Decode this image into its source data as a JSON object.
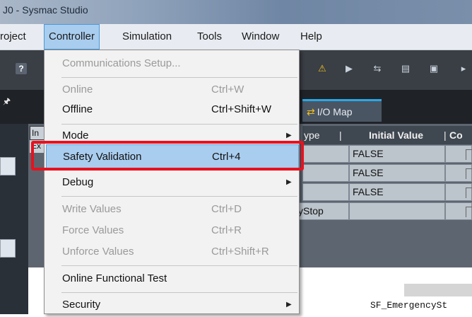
{
  "window": {
    "title": "J0 - Sysmac Studio"
  },
  "menubar": {
    "items": [
      {
        "label": "roject"
      },
      {
        "label": "Controller"
      },
      {
        "label": "Simulation"
      },
      {
        "label": "Tools"
      },
      {
        "label": "Window"
      },
      {
        "label": "Help"
      }
    ]
  },
  "toolbar": {
    "icons": [
      "help-icon",
      "safety-icon",
      "step-icon",
      "sync-icon",
      "transfer-icon",
      "compare-icon",
      "more-icon"
    ]
  },
  "tabs": {
    "io_map": "I/O Map"
  },
  "panel": {
    "in_label": "In",
    "e_label": "Ex"
  },
  "grid": {
    "headers": [
      "ype",
      "Initial Value",
      "Co"
    ],
    "rows": [
      {
        "type": "",
        "initial": "FALSE"
      },
      {
        "type": "",
        "initial": "FALSE"
      },
      {
        "type": "",
        "initial": "FALSE"
      },
      {
        "type": "cyStop",
        "initial": ""
      }
    ]
  },
  "code": {
    "text": "SF_EmergencySt"
  },
  "controller_menu": {
    "items": [
      {
        "label": "Communications Setup...",
        "shortcut": "",
        "enabled": false,
        "submenu": false
      },
      {
        "label": "Online",
        "shortcut": "Ctrl+W",
        "enabled": false,
        "submenu": false
      },
      {
        "label": "Offline",
        "shortcut": "Ctrl+Shift+W",
        "enabled": true,
        "submenu": false
      },
      {
        "label": "Mode",
        "shortcut": "",
        "enabled": true,
        "submenu": true
      },
      {
        "label": "Safety Validation",
        "shortcut": "Ctrl+4",
        "enabled": true,
        "submenu": false,
        "highlighted": true
      },
      {
        "label": "Debug",
        "shortcut": "",
        "enabled": true,
        "submenu": true
      },
      {
        "label": "Write Values",
        "shortcut": "Ctrl+D",
        "enabled": false,
        "submenu": false
      },
      {
        "label": "Force Values",
        "shortcut": "Ctrl+R",
        "enabled": false,
        "submenu": false
      },
      {
        "label": "Unforce Values",
        "shortcut": "Ctrl+Shift+R",
        "enabled": false,
        "submenu": false
      },
      {
        "label": "Online Functional Test",
        "shortcut": "",
        "enabled": true,
        "submenu": false
      },
      {
        "label": "Security",
        "shortcut": "",
        "enabled": true,
        "submenu": true
      }
    ]
  },
  "colors": {
    "highlight": "#a9cdee",
    "annotation_red": "#e8111f",
    "tab_accent": "#2aa8e6"
  }
}
